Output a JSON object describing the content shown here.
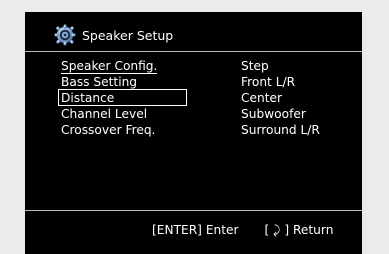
{
  "header": {
    "title": "Speaker Setup",
    "icon": "speaker-settings-icon"
  },
  "menu": {
    "items": [
      {
        "label": "Speaker Config."
      },
      {
        "label": "Bass Setting"
      },
      {
        "label": "Distance"
      },
      {
        "label": "Channel Level"
      },
      {
        "label": "Crossover Freq."
      }
    ],
    "selected_index": 2
  },
  "options": [
    "Step",
    "Front L/R",
    "Center",
    "Subwoofer",
    "Surround L/R"
  ],
  "footer": {
    "enter_hint": "[ENTER] Enter",
    "return_hint": "[ ⤸ ] Return"
  },
  "colors": {
    "background": "#000000",
    "text": "#ffffff",
    "rule": "#bdbdbd"
  }
}
